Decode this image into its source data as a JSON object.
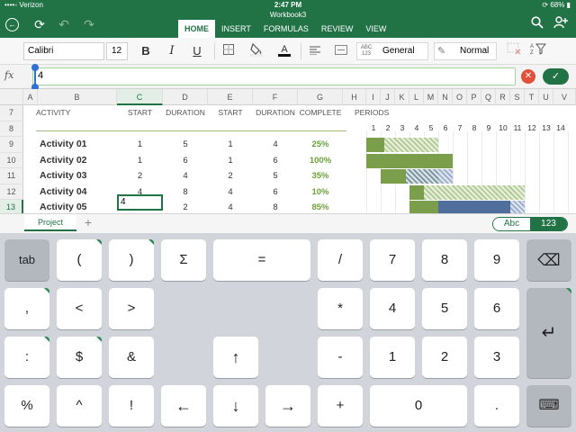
{
  "status_bar": {
    "carrier": "••••◦ Verizon",
    "wifi_icon": "wifi-icon",
    "time": "2:47 PM",
    "battery": "68%"
  },
  "titlebar": {
    "workbook_name": "Workbook3",
    "back_icon": "back-arrow-icon",
    "undo_icon": "undo-icon",
    "redo_icon": "redo-icon",
    "file_icon": "file-refresh-icon",
    "search_icon": "search-icon",
    "share_icon": "add-person-icon"
  },
  "tabs": [
    {
      "label": "HOME",
      "active": true
    },
    {
      "label": "INSERT",
      "active": false
    },
    {
      "label": "FORMULAS",
      "active": false
    },
    {
      "label": "REVIEW",
      "active": false
    },
    {
      "label": "VIEW",
      "active": false
    }
  ],
  "ribbon": {
    "font_name": "Calibri",
    "font_size": "12",
    "bold": "B",
    "italic": "I",
    "underline": "U",
    "number_format_icon_text": "ABC\n123",
    "number_format": "General",
    "cell_style": "Normal"
  },
  "formula_bar": {
    "fx_label": "fx",
    "value": "4",
    "cancel_glyph": "✕",
    "confirm_glyph": "✓"
  },
  "columns": [
    "A",
    "B",
    "C",
    "D",
    "E",
    "F",
    "G",
    "H",
    "I",
    "J",
    "K",
    "L",
    "M",
    "N",
    "O",
    "P",
    "Q",
    "R",
    "S",
    "T",
    "U",
    "V"
  ],
  "selected_column": "C",
  "rows": [
    "7",
    "8",
    "9",
    "10",
    "11",
    "12",
    "13"
  ],
  "selected_row": "13",
  "headers": {
    "activity": "ACTIVITY",
    "start": "START",
    "duration": "DURATION",
    "start2": "START",
    "duration2": "DURATION",
    "complete": "COMPLETE",
    "periods": "PERIODS"
  },
  "periods": [
    "1",
    "2",
    "3",
    "4",
    "5",
    "6",
    "7",
    "8",
    "9",
    "10",
    "11",
    "12",
    "13",
    "14"
  ],
  "activities": [
    {
      "name": "Activity 01",
      "plan_start": "1",
      "plan_duration": "5",
      "actual_start": "1",
      "actual_duration": "4",
      "complete": "25%"
    },
    {
      "name": "Activity 02",
      "plan_start": "1",
      "plan_duration": "6",
      "actual_start": "1",
      "actual_duration": "6",
      "complete": "100%"
    },
    {
      "name": "Activity 03",
      "plan_start": "2",
      "plan_duration": "4",
      "actual_start": "2",
      "actual_duration": "5",
      "complete": "35%"
    },
    {
      "name": "Activity 04",
      "plan_start": "4",
      "plan_duration": "8",
      "actual_start": "4",
      "actual_duration": "6",
      "complete": "10%"
    },
    {
      "name": "Activity 05",
      "plan_start": "4",
      "plan_duration": "2",
      "actual_start": "4",
      "actual_duration": "8",
      "complete": "85%"
    }
  ],
  "editing_cell_value": "4",
  "sheet": {
    "name": "Project",
    "add_glyph": "+"
  },
  "keyboard_toggle": {
    "abc": "Abc",
    "num": "123"
  },
  "keyboard": {
    "row1": [
      "tab",
      "(",
      ")",
      "Σ",
      "=",
      "/",
      "7",
      "8",
      "9",
      "⌫"
    ],
    "row2": [
      ",",
      "<",
      ">",
      "*",
      "4",
      "5",
      "6",
      "↵"
    ],
    "row3": [
      ":",
      "$",
      "&",
      "↑",
      "-",
      "1",
      "2",
      "3"
    ],
    "row4": [
      "%",
      "^",
      "!",
      "←",
      "↓",
      "→",
      "+",
      "0",
      ".",
      "⌨"
    ]
  },
  "colors": {
    "brand_green": "#217346",
    "complete_green": "#6ba339",
    "bar_green": "#7a9e4a",
    "bar_blue": "#4f6e9c"
  }
}
